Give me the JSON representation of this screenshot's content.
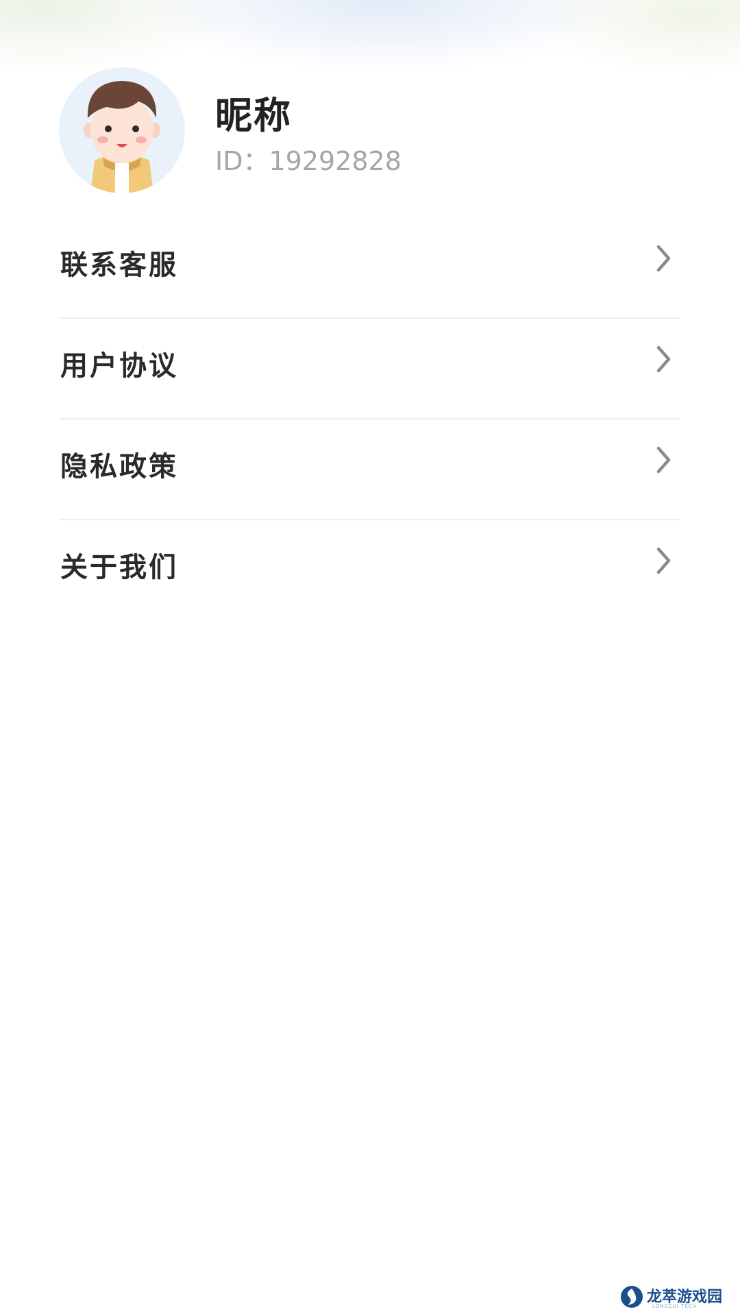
{
  "profile": {
    "nickname": "昵称",
    "id_text": "ID：19292828"
  },
  "menu": {
    "items": [
      {
        "label": "联系客服",
        "icon": "chevron-right-icon"
      },
      {
        "label": "用户协议",
        "icon": "chevron-right-icon"
      },
      {
        "label": "隐私政策",
        "icon": "chevron-right-icon"
      },
      {
        "label": "关于我们",
        "icon": "chevron-right-icon"
      }
    ]
  },
  "watermark": {
    "brand": "龙萃游戏园",
    "sub": "LONGCUI TECH"
  },
  "colors": {
    "text_primary": "#222222",
    "text_secondary": "#a6a6a6",
    "divider": "#eeeeee",
    "chevron": "#8a8a8a",
    "watermark_blue": "#1a4e8c"
  }
}
